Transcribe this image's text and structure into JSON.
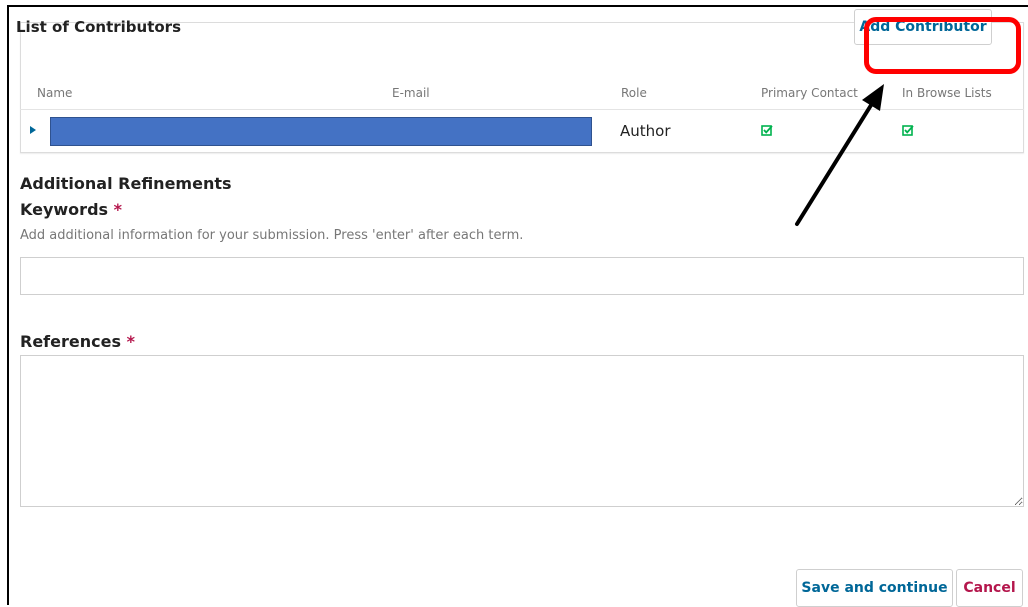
{
  "contributors": {
    "title": "List of Contributors",
    "add_button_label": "Add Contributor",
    "columns": [
      "Name",
      "E-mail",
      "Role",
      "Primary Contact",
      "In Browse Lists"
    ],
    "rows": [
      {
        "role": "Author",
        "primary_contact": true,
        "in_browse_lists": true
      }
    ]
  },
  "refinements": {
    "heading": "Additional Refinements",
    "keywords": {
      "label": "Keywords",
      "required_mark": "*",
      "help": "Add additional information for your submission. Press 'enter' after each term.",
      "value": "",
      "placeholder": ""
    },
    "references": {
      "label": "References",
      "required_mark": "*",
      "value": "",
      "placeholder": ""
    }
  },
  "actions": {
    "save_label": "Save and continue",
    "cancel_label": "Cancel"
  },
  "annotation": {
    "highlight_color": "#ff0000",
    "arrow_color": "#000000"
  },
  "colors": {
    "link_blue": "#006798",
    "required_red": "#b4164c",
    "check_green": "#00b24e",
    "redaction_blue": "#4472c4"
  },
  "icons": {
    "expand": "triangle-right",
    "check": "checkbox-checked"
  }
}
